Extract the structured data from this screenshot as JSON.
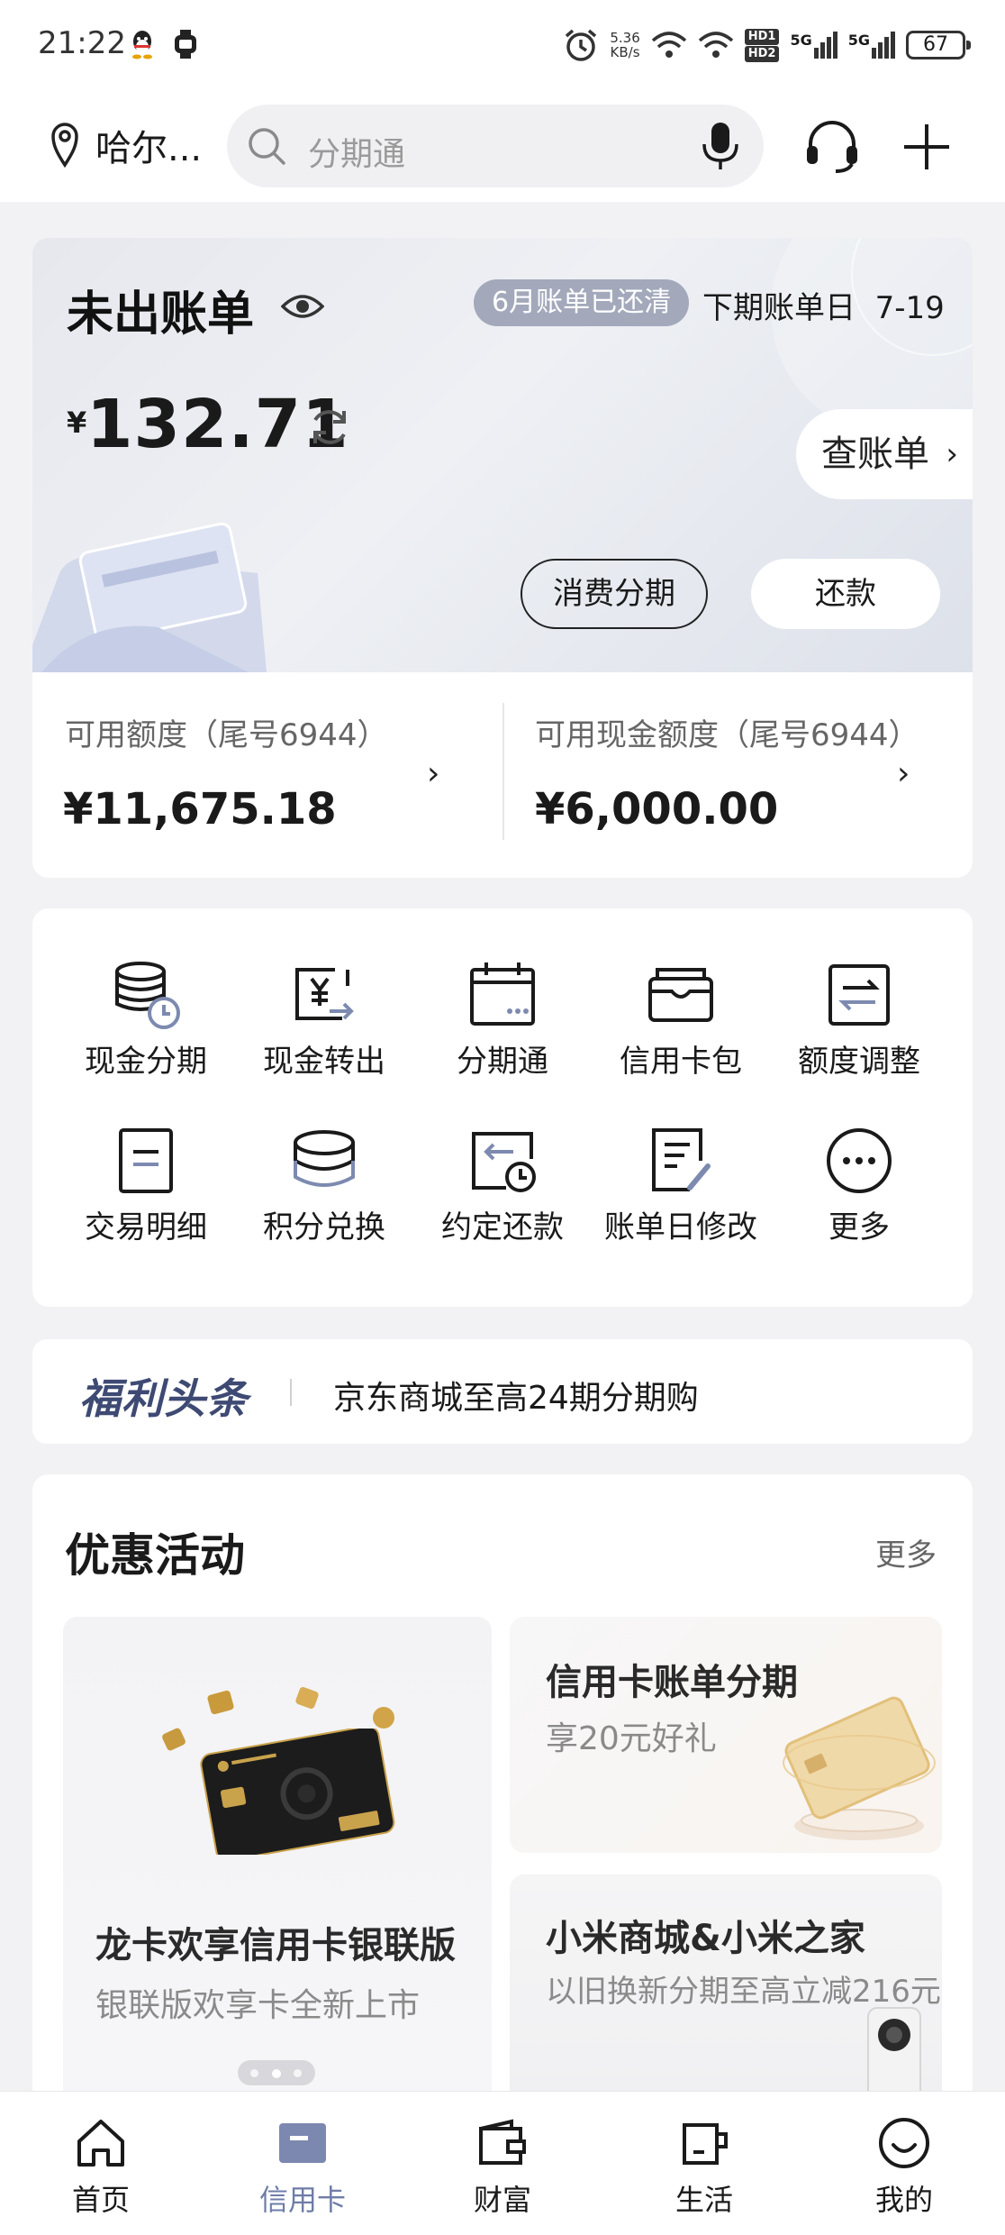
{
  "status_bar": {
    "time": "21:22",
    "net_speed_value": "5.36",
    "net_speed_unit": "KB/s",
    "hd1": "HD1",
    "hd2": "HD2",
    "signal1": "5G",
    "signal2": "5G",
    "battery": "67"
  },
  "header": {
    "location": "哈尔...",
    "search_placeholder": "分期通"
  },
  "bill": {
    "title": "未出账单",
    "paid_badge": "6月账单已还清",
    "next_bill_label": "下期账单日",
    "next_bill_date": "7-19",
    "currency": "¥",
    "amount": "132.71",
    "view_bill_label": "查账单",
    "installment_label": "消费分期",
    "repay_label": "还款"
  },
  "credit": {
    "available_label": "可用额度（尾号6944）",
    "available_value": "¥11,675.18",
    "cash_label": "可用现金额度（尾号6944）",
    "cash_value": "¥6,000.00"
  },
  "functions": [
    {
      "label": "现金分期",
      "icon": "coins-clock-icon"
    },
    {
      "label": "现金转出",
      "icon": "yen-transfer-icon"
    },
    {
      "label": "分期通",
      "icon": "calendar-icon"
    },
    {
      "label": "信用卡包",
      "icon": "card-wallet-icon"
    },
    {
      "label": "额度调整",
      "icon": "limit-adjust-icon"
    },
    {
      "label": "交易明细",
      "icon": "document-icon"
    },
    {
      "label": "积分兑换",
      "icon": "coin-stack-icon"
    },
    {
      "label": "约定还款",
      "icon": "scheduled-repay-icon"
    },
    {
      "label": "账单日修改",
      "icon": "bill-edit-icon"
    },
    {
      "label": "更多",
      "icon": "more-icon"
    }
  ],
  "news": {
    "tag": "福利头条",
    "text": "京东商城至高24期分期购"
  },
  "promotions": {
    "title": "优惠活动",
    "more": "更多",
    "left": {
      "title": "龙卡欢享信用卡银联版",
      "subtitle": "银联版欢享卡全新上市"
    },
    "right_top": {
      "title": "信用卡账单分期",
      "subtitle": "享20元好礼"
    },
    "right_bottom": {
      "title": "小米商城&小米之家",
      "subtitle": "以旧换新分期至高立减216元"
    }
  },
  "nav": [
    {
      "label": "首页",
      "icon": "home-icon",
      "active": false
    },
    {
      "label": "信用卡",
      "icon": "credit-card-icon",
      "active": true
    },
    {
      "label": "财富",
      "icon": "wallet-icon",
      "active": false
    },
    {
      "label": "生活",
      "icon": "cup-icon",
      "active": false
    },
    {
      "label": "我的",
      "icon": "smile-icon",
      "active": false
    }
  ],
  "colors": {
    "accent": "#6e7ca8",
    "badge": "#a3a9bb",
    "news_tag": "#3e4a73"
  }
}
